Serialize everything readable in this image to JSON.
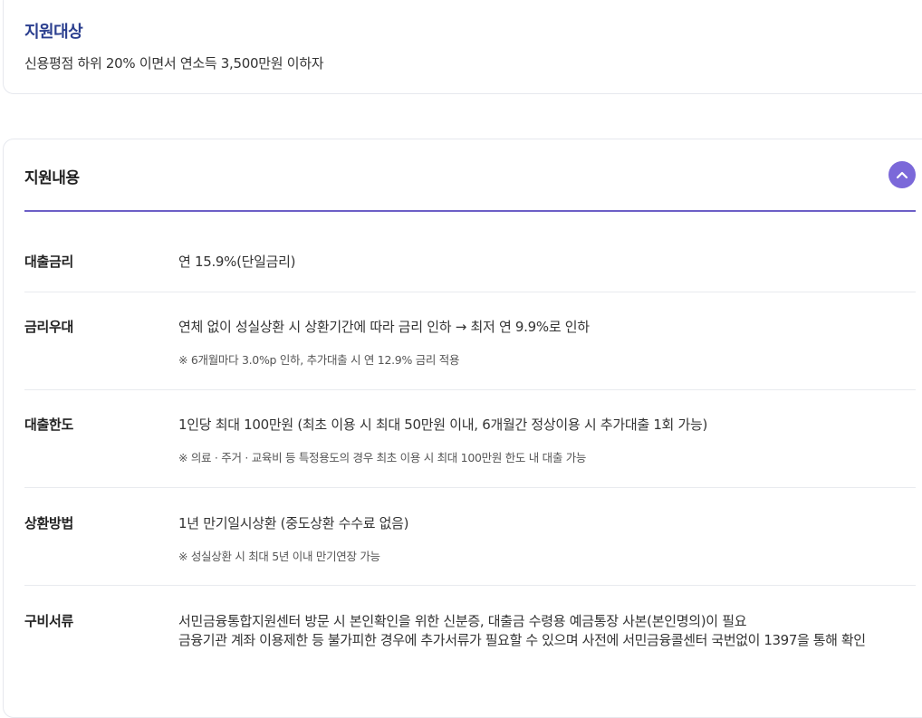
{
  "target": {
    "title": "지원대상",
    "description": "신용평점 하위 20% 이면서 연소득 3,500만원 이하자"
  },
  "content": {
    "title": "지원내용",
    "toggle_icon": "chevron-up-icon",
    "accent_color": "#7b68d9",
    "rows": [
      {
        "label": "대출금리",
        "value": "연 15.9%(단일금리)"
      },
      {
        "label": "금리우대",
        "value": "연체 없이 성실상환 시 상환기간에 따라 금리 인하 → 최저 연 9.9%로 인하",
        "note": "※ 6개월마다 3.0%p 인하, 추가대출 시 연 12.9% 금리 적용"
      },
      {
        "label": "대출한도",
        "value": "1인당 최대 100만원 (최초 이용 시 최대 50만원 이내, 6개월간 정상이용 시 추가대출 1회 가능)",
        "note": "※ 의료 · 주거 · 교육비 등 특정용도의 경우 최초 이용 시 최대 100만원 한도 내 대출 가능"
      },
      {
        "label": "상환방법",
        "value": "1년 만기일시상환 (중도상환 수수료 없음)",
        "note": "※ 성실상환 시 최대 5년 이내 만기연장 가능"
      },
      {
        "label": "구비서류",
        "value": "서민금융통합지원센터 방문 시 본인확인을 위한 신분증, 대출금 수령용 예금통장 사본(본인명의)이 필요",
        "value2": "금융기관 계좌 이용제한 등 불가피한 경우에 추가서류가 필요할 수 있으며 사전에 서민금융콜센터 국번없이 1397을 통해 확인"
      }
    ]
  }
}
